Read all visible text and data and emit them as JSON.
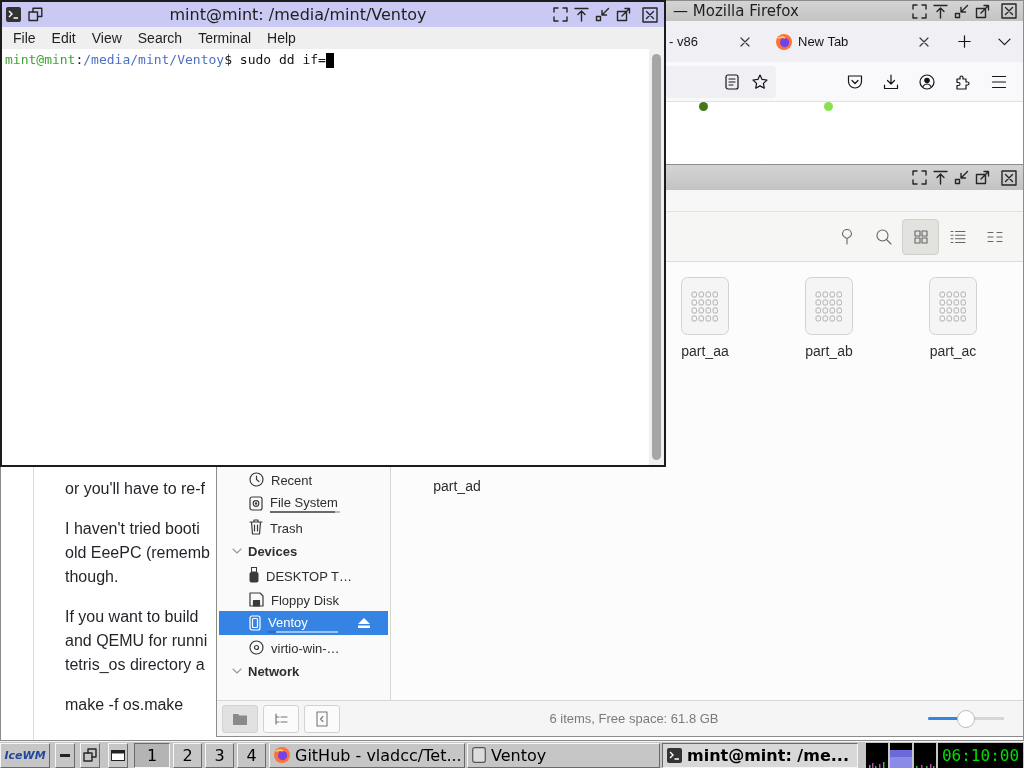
{
  "browser_window": {
    "focused": false,
    "title": "— Mozilla Firefox",
    "tabs": [
      {
        "kind": "page",
        "label": "- v86",
        "selected": false
      },
      {
        "kind": "new_tab",
        "label": "New Tab",
        "selected": false
      }
    ],
    "page": {
      "language_dots": [
        {
          "color": "#427819"
        },
        {
          "color": "#89e051"
        }
      ],
      "paragraphs": [
        [
          "or you'll have to re-f"
        ],
        [
          "I haven't tried booti",
          "old EeePC (rememb",
          "though."
        ],
        [
          "If you want to build",
          "and QEMU for runni",
          "tetris_os directory a"
        ],
        [
          "make -f os.make"
        ]
      ]
    }
  },
  "file_manager_window": {
    "focused": false,
    "view_modes": [
      {
        "kind": "icons",
        "selected": true
      },
      {
        "kind": "list",
        "selected": false
      },
      {
        "kind": "compact",
        "selected": false
      }
    ],
    "sidebar": {
      "places": [
        {
          "kind": "recent",
          "label": "Recent",
          "selected": false
        },
        {
          "kind": "harddisk",
          "label": "File System",
          "selected": false,
          "usage": {
            "level": 0.93
          }
        },
        {
          "kind": "trash",
          "label": "Trash",
          "selected": false
        }
      ],
      "sections": [
        {
          "title": "Devices",
          "expanded": true,
          "items": [
            {
              "kind": "usb",
              "label": "DESKTOP T…",
              "selected": false,
              "eject": false
            },
            {
              "kind": "floppy",
              "label": "Floppy Disk",
              "selected": false,
              "eject": false
            },
            {
              "kind": "removable",
              "label": "Ventoy",
              "selected": true,
              "eject": true,
              "usage": {
                "level": 0.12
              }
            },
            {
              "kind": "disc",
              "label": "virtio-win-…",
              "selected": false,
              "eject": false
            }
          ]
        },
        {
          "title": "Network",
          "expanded": true
        }
      ]
    },
    "files": [
      {
        "name": "part_aa"
      },
      {
        "name": "part_ab"
      },
      {
        "name": "part_ac"
      },
      {
        "name": "part_ad"
      }
    ],
    "sidebar_modes": [
      {
        "kind": "places",
        "selected": true
      },
      {
        "kind": "tree",
        "selected": false
      }
    ],
    "status": "6 items, Free space: 61.8 GB",
    "zoom": {
      "level": 0.5
    }
  },
  "terminal_window": {
    "focused": true,
    "title": "mint@mint: /media/mint/Ventoy",
    "menu": [
      "File",
      "Edit",
      "View",
      "Search",
      "Terminal",
      "Help"
    ],
    "prompt": {
      "user": "mint@mint",
      "separator": ":",
      "path": "/media/mint/Ventoy",
      "input": "$ sudo dd if="
    }
  },
  "taskbar": {
    "logo": "IceWM",
    "workspaces": [
      {
        "label": "1",
        "selected": true
      },
      {
        "label": "2",
        "selected": false
      },
      {
        "label": "3",
        "selected": false
      },
      {
        "label": "4",
        "selected": false
      }
    ],
    "tasks": [
      {
        "kind": "browser",
        "title": "GitHub - vladcc/Tet...",
        "selected": false
      },
      {
        "kind": "folder",
        "title": "Ventoy",
        "selected": false
      },
      {
        "kind": "terminal",
        "title": "mint@mint: /me...",
        "selected": true
      }
    ],
    "clock": "06:10:00"
  }
}
